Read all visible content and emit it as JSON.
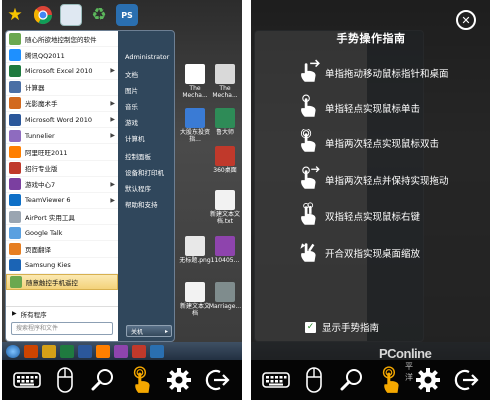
{
  "left_screen": {
    "start_menu": {
      "items": [
        {
          "label": "随心所欲地控制您的软件",
          "icon": "dreammobile-icon",
          "color": "#6aa84f"
        },
        {
          "label": "腾讯QQ2011",
          "icon": "qq-icon",
          "color": "#1e90ff"
        },
        {
          "label": "Microsoft Excel 2010",
          "icon": "excel-icon",
          "color": "#1f7a3f",
          "arrow": "▶"
        },
        {
          "label": "计算器",
          "icon": "calculator-icon",
          "color": "#4a6fa5"
        },
        {
          "label": "光影魔术手",
          "icon": "neoimaging-icon",
          "color": "#d2691e",
          "arrow": "▶"
        },
        {
          "label": "Microsoft Word 2010",
          "icon": "word-icon",
          "color": "#2b579a",
          "arrow": "▶"
        },
        {
          "label": "Tunnelier",
          "icon": "tunnelier-icon",
          "color": "#8e6bbf",
          "arrow": "▶"
        },
        {
          "label": "阿里旺旺2011",
          "icon": "aliwangwang-icon",
          "color": "#ff7f00"
        },
        {
          "label": "招行专业版",
          "icon": "cmb-icon",
          "color": "#c0392b"
        },
        {
          "label": "游戏中心7",
          "icon": "game-center-icon",
          "color": "#7b3fa0",
          "arrow": "▶"
        },
        {
          "label": "TeamViewer 6",
          "icon": "teamviewer-icon",
          "color": "#0e6fc7",
          "arrow": "▶"
        },
        {
          "label": "AirPort 实用工具",
          "icon": "airport-icon",
          "color": "#9aa5b1"
        },
        {
          "label": "Google Talk",
          "icon": "google-talk-icon",
          "color": "#5aa0e0"
        },
        {
          "label": "页面翻译",
          "icon": "translate-icon",
          "color": "#e67e22"
        },
        {
          "label": "Samsung Kies",
          "icon": "samsung-kies-icon",
          "color": "#1b64b5"
        },
        {
          "label": "随意触控手机遥控",
          "icon": "remote-icon",
          "color": "#6aa84f",
          "highlighted": true
        }
      ],
      "all_programs": "所有程序",
      "search_placeholder": "搜索程序和文件",
      "right_items": [
        {
          "label": "Administrator"
        },
        {
          "label": "文档"
        },
        {
          "label": "图片"
        },
        {
          "label": "音乐"
        },
        {
          "label": "游戏"
        },
        {
          "label": "计算机"
        },
        {
          "label": "控制面板"
        },
        {
          "label": "设备和打印机"
        },
        {
          "label": "默认程序"
        },
        {
          "label": "帮助和支持"
        }
      ],
      "shutdown_label": "关机"
    },
    "desktop_icons": [
      {
        "label": "The Mecha...",
        "color": "#ffffff"
      },
      {
        "label": "The Mecha...",
        "color": "#d9d9d9"
      },
      {
        "label": "大股东投资指...",
        "color": "#3a7bd5"
      },
      {
        "label": "鲁大师",
        "color": "#2e8b57"
      },
      {
        "label": "360桌面",
        "color": "#c0392b"
      },
      {
        "label": "新建文本文档.txt",
        "color": "#f2f2f2"
      },
      {
        "label": "无标题.png",
        "color": "#e8e8e8"
      },
      {
        "label": "110405...",
        "color": "#8e44ad"
      },
      {
        "label": "新建文本文档",
        "color": "#f2f2f2"
      },
      {
        "label": "Marriage...",
        "color": "#7f8c8d"
      }
    ]
  },
  "right_screen": {
    "guide_title": "手势操作指南",
    "close_icon": "close-icon",
    "gestures": [
      {
        "text": "单指拖动移动鼠标指针和桌面",
        "icon": "one-finger-drag-icon"
      },
      {
        "text": "单指轻点实现鼠标单击",
        "icon": "one-finger-tap-icon"
      },
      {
        "text": "单指两次轻点实现鼠标双击",
        "icon": "one-finger-double-tap-icon"
      },
      {
        "text": "单指两次轻点并保持实现拖动",
        "icon": "one-finger-tap-hold-icon"
      },
      {
        "text": "双指轻点实现鼠标右键",
        "icon": "two-finger-tap-icon"
      },
      {
        "text": "开合双指实现桌面缩放",
        "icon": "pinch-zoom-icon"
      }
    ],
    "show_guide_label": "显示手势指南",
    "show_guide_checked": true
  },
  "toolbar": {
    "buttons": [
      {
        "icon": "keyboard-icon"
      },
      {
        "icon": "mouse-icon"
      },
      {
        "icon": "zoom-icon"
      },
      {
        "icon": "gesture-icon",
        "active": true
      },
      {
        "icon": "settings-icon"
      },
      {
        "icon": "exit-icon"
      }
    ],
    "active_color": "#f5a800"
  },
  "watermark": {
    "text": "PConline",
    "sub": "平 洋"
  }
}
